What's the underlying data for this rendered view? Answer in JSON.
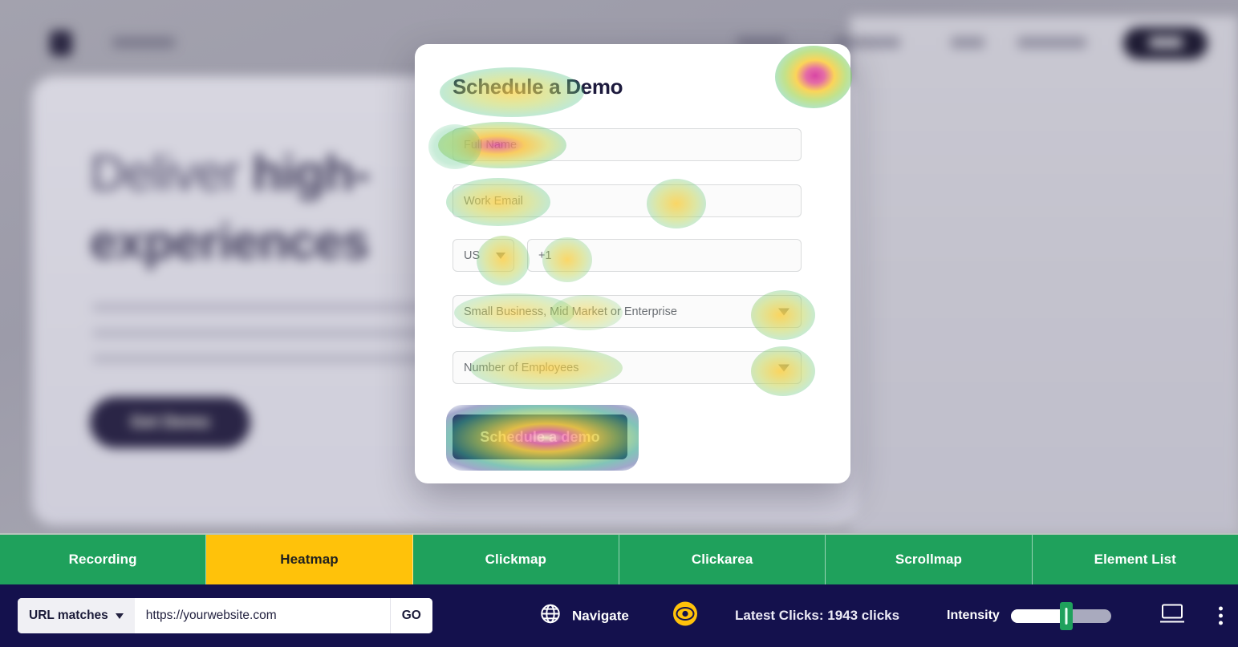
{
  "backdrop": {
    "headline_line1_light": "Deliver ",
    "headline_line1_bold": "high-",
    "headline_line2": "experiences",
    "cta_label": "Get Demo"
  },
  "modal": {
    "title_bold": "Schedule",
    "title_rest": " a Demo",
    "close_icon": "close-icon",
    "fields": {
      "full_name_placeholder": "Full Name",
      "work_email_placeholder": "Work Email",
      "country_code_value": "US",
      "phone_placeholder": "+1",
      "segment_placeholder": "Small Business, Mid Market or Enterprise",
      "employees_placeholder": "Number of Employees"
    },
    "submit_label": "Schedule a demo"
  },
  "tabs": [
    {
      "label": "Recording",
      "active": false
    },
    {
      "label": "Heatmap",
      "active": true
    },
    {
      "label": "Clickmap",
      "active": false
    },
    {
      "label": "Clickarea",
      "active": false
    },
    {
      "label": "Scrollmap",
      "active": false
    },
    {
      "label": "Element List",
      "active": false
    }
  ],
  "toolbar": {
    "url_match_label": "URL matches",
    "url_value": "https://yourwebsite.com",
    "url_placeholder": "https://yourwebsite.com",
    "go_label": "GO",
    "navigate_label": "Navigate",
    "globe_icon": "globe-icon",
    "eye_icon": "eye-icon",
    "clicks_text": "Latest Clicks: 1943 clicks",
    "intensity_label": "Intensity",
    "intensity_percent": 55,
    "device_icon": "desktop-icon",
    "more_icon": "kebab-menu-icon"
  },
  "colors": {
    "tab_active": "#ffc20a",
    "tab_inactive": "#1fa15c",
    "toolbar_bg": "#14114d",
    "slider_thumb": "#1fa15c",
    "modal_cta": "#2a2450"
  }
}
